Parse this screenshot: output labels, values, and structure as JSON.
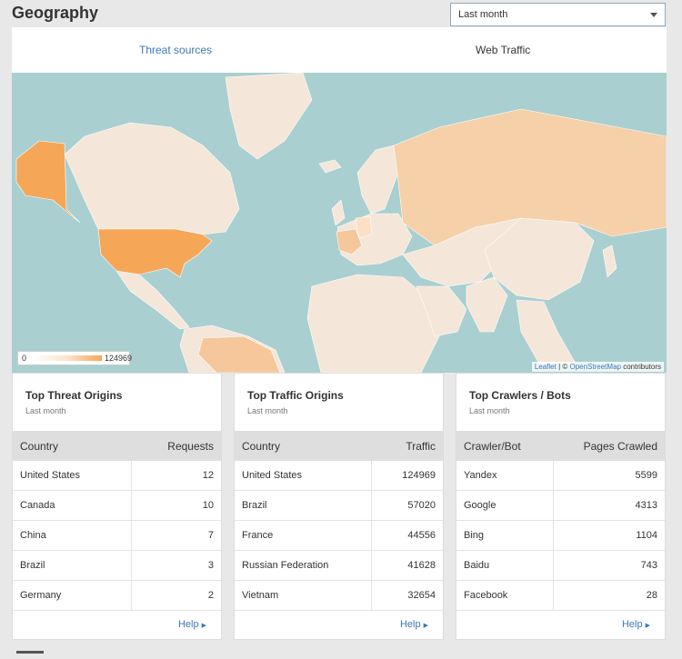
{
  "header": {
    "title": "Geography",
    "range": "Last month"
  },
  "tabs": [
    {
      "label": "Threat sources"
    },
    {
      "label": "Web Traffic"
    }
  ],
  "map": {
    "legend_min": "0",
    "legend_max": "124969",
    "attribution_link1": "Leaflet",
    "attribution_sep": " | © ",
    "attribution_link2": "OpenStreetMap",
    "attribution_tail": " contributors"
  },
  "cards": [
    {
      "title": "Top Threat Origins",
      "subtitle": "Last month",
      "col1": "Country",
      "col2": "Requests",
      "rows": [
        {
          "name": "United States",
          "value": "12"
        },
        {
          "name": "Canada",
          "value": "10"
        },
        {
          "name": "China",
          "value": "7"
        },
        {
          "name": "Brazil",
          "value": "3"
        },
        {
          "name": "Germany",
          "value": "2"
        }
      ],
      "help": "Help"
    },
    {
      "title": "Top Traffic Origins",
      "subtitle": "Last month",
      "col1": "Country",
      "col2": "Traffic",
      "rows": [
        {
          "name": "United States",
          "value": "124969"
        },
        {
          "name": "Brazil",
          "value": "57020"
        },
        {
          "name": "France",
          "value": "44556"
        },
        {
          "name": "Russian Federation",
          "value": "41628"
        },
        {
          "name": "Vietnam",
          "value": "32654"
        }
      ],
      "help": "Help"
    },
    {
      "title": "Top Crawlers / Bots",
      "subtitle": "Last month",
      "col1": "Crawler/Bot",
      "col2": "Pages Crawled",
      "rows": [
        {
          "name": "Yandex",
          "value": "5599"
        },
        {
          "name": "Google",
          "value": "4313"
        },
        {
          "name": "Bing",
          "value": "1104"
        },
        {
          "name": "Baidu",
          "value": "743"
        },
        {
          "name": "Facebook",
          "value": "28"
        }
      ],
      "help": "Help"
    }
  ],
  "colors": {
    "ocean": "#aacfd0",
    "land": "#f4e6d9",
    "high": "#f5a657",
    "mid": "#f6d0a8",
    "link": "#3a78b8"
  }
}
